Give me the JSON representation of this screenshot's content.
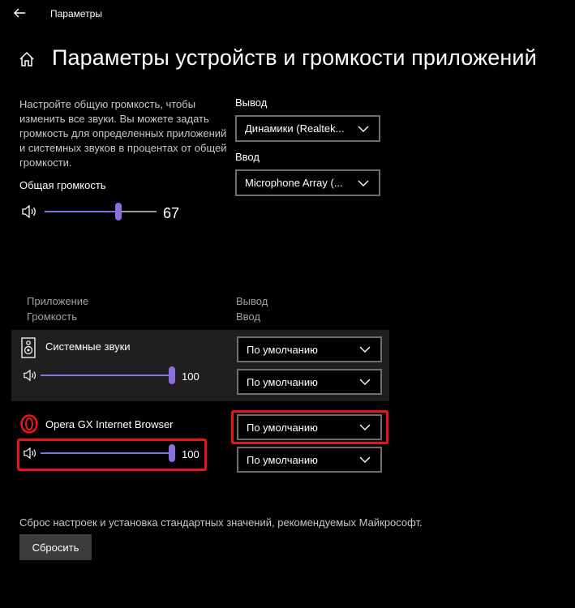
{
  "window": {
    "title": "Параметры"
  },
  "page": {
    "title": "Параметры устройств и громкости приложений",
    "description": "Настройте общую громкость, чтобы изменить все звуки. Вы можете задать громкость для определенных приложений и системных звуков в процентах от общей громкости."
  },
  "master": {
    "label": "Общая громкость",
    "value": "67",
    "level": 0.67
  },
  "output": {
    "label": "Вывод",
    "selected": "Динамики (Realtek..."
  },
  "input": {
    "label": "Ввод",
    "selected": "Microphone Array (..."
  },
  "columns": {
    "app": "Приложение",
    "volume": "Громкость",
    "output": "Вывод",
    "input": "Ввод"
  },
  "apps": [
    {
      "name": "Системные звуки",
      "icon": "system-sounds-icon",
      "value": "100",
      "level": 1.0,
      "output": "По умолчанию",
      "input": "По умолчанию"
    },
    {
      "name": "Opera GX Internet Browser",
      "icon": "opera-gx-icon",
      "value": "100",
      "level": 1.0,
      "output": "По умолчанию",
      "input": "По умолчанию"
    }
  ],
  "reset": {
    "text": "Сброс настроек и установка стандартных значений, рекомендуемых Майкрософт.",
    "button": "Сбросить"
  },
  "colors": {
    "accent": "#8b6ee0",
    "highlight": "#e8151a",
    "row_bg": "#1f1f1f"
  }
}
